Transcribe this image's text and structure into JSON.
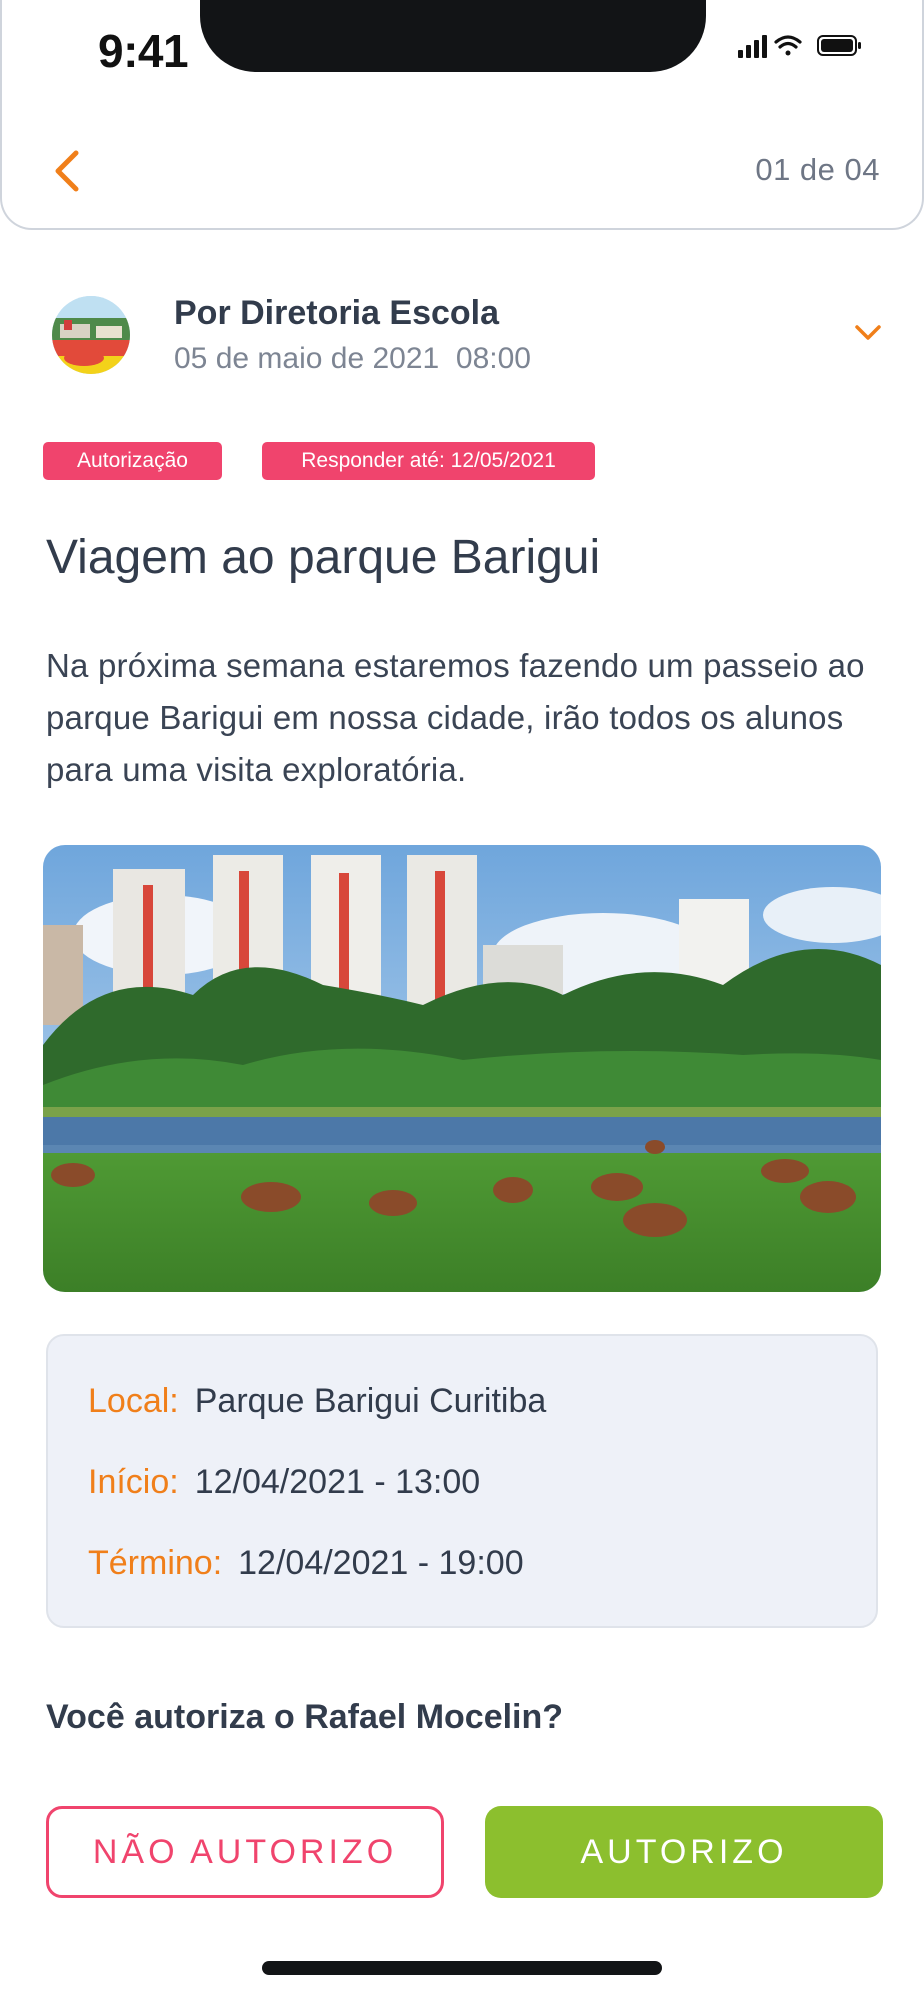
{
  "status_bar": {
    "time": "9:41"
  },
  "header": {
    "page_counter": "01 de 04"
  },
  "post": {
    "author": "Por Diretoria Escola",
    "date": "05 de maio de 2021  08:00",
    "tags": {
      "type": "Autorização",
      "deadline": "Responder até: 12/05/2021"
    },
    "title": "Viagem ao parque Barigui",
    "body": "Na próxima semana estaremos fazendo um passeio ao parque Barigui em nossa cidade, irão todos os alunos para uma visita exploratória."
  },
  "event": {
    "location_label": "Local:",
    "location": "Parque Barigui Curitiba",
    "start_label": "Início:",
    "start": "12/04/2021 - 13:00",
    "end_label": "Término:",
    "end": "12/04/2021 - 19:00"
  },
  "authorization": {
    "question": "Você autoriza o Rafael Mocelin?",
    "deny_label": "NÃO AUTORIZO",
    "allow_label": "AUTORIZO"
  },
  "colors": {
    "accent_orange": "#f07f1a",
    "tag_pink": "#f0446d",
    "approve_green": "#8cbf2e",
    "text_dark": "#323c4c",
    "card_bg": "#eef1f8"
  },
  "icons": [
    "back-chevron-icon",
    "chevron-down-icon",
    "signal-icon",
    "wifi-icon",
    "battery-icon"
  ]
}
